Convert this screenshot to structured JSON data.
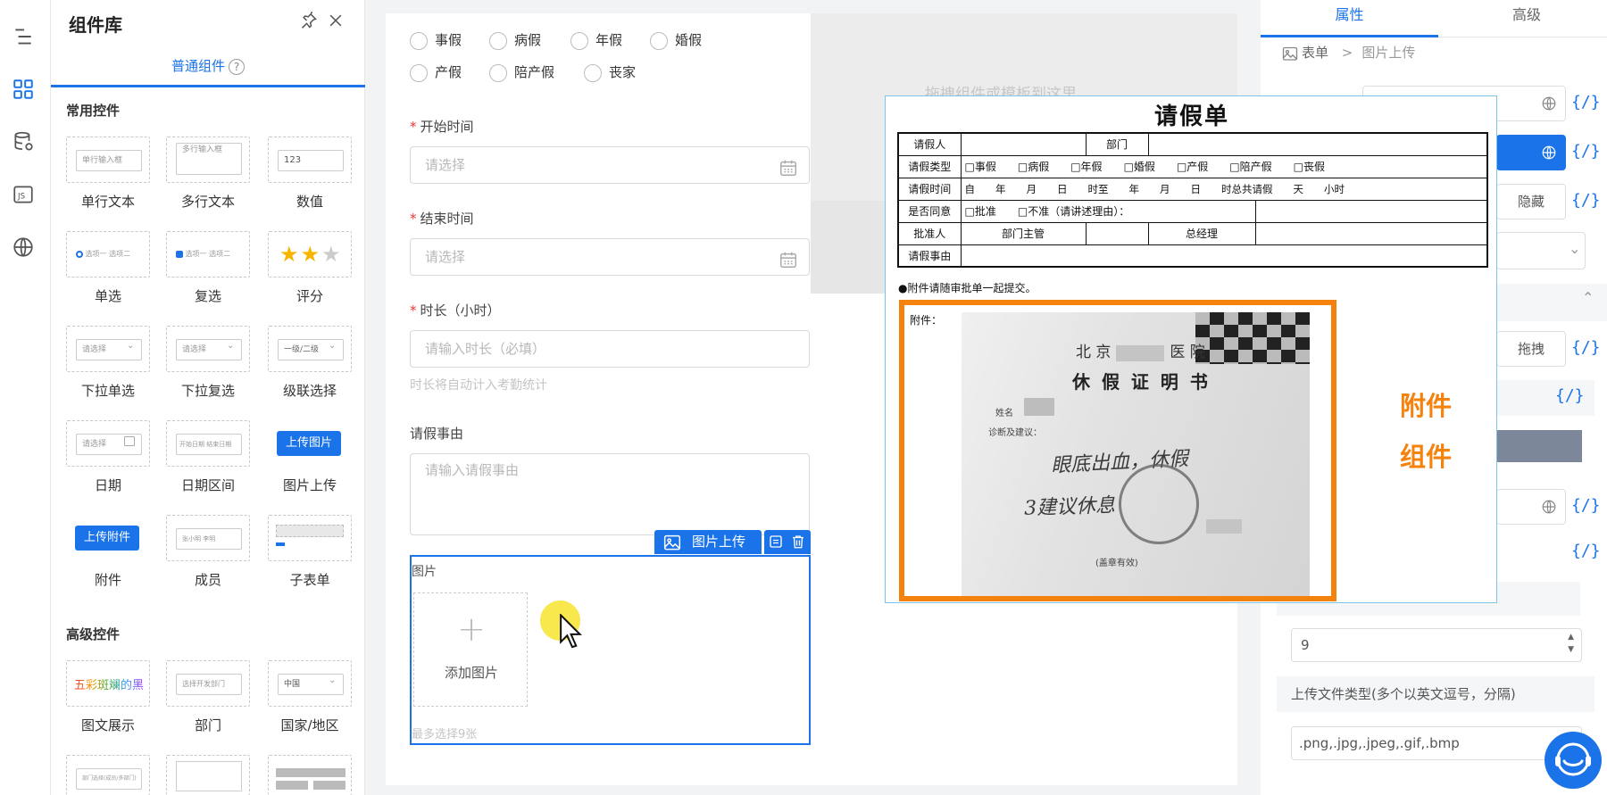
{
  "panel": {
    "title": "组件库",
    "tab_normal": "普通组件",
    "help": "?",
    "group_common": "常用控件",
    "group_advanced": "高级控件",
    "components": [
      {
        "label": "单行文本",
        "preview": "单行输入框"
      },
      {
        "label": "多行文本",
        "preview": "多行输入框"
      },
      {
        "label": "数值",
        "preview": "123"
      },
      {
        "label": "单选",
        "preview": "选项一 选项二"
      },
      {
        "label": "复选",
        "preview": "选项一 选项二"
      },
      {
        "label": "评分",
        "preview": ""
      },
      {
        "label": "下拉单选",
        "preview": "请选择"
      },
      {
        "label": "下拉复选",
        "preview": "请选择"
      },
      {
        "label": "级联选择",
        "preview": "一级/二级"
      },
      {
        "label": "日期",
        "preview": "请选择"
      },
      {
        "label": "日期区间",
        "preview": "开始日期 结束日期"
      },
      {
        "label": "图片上传",
        "preview": "上传图片"
      },
      {
        "label": "附件",
        "preview": "上传附件"
      },
      {
        "label": "成员",
        "preview": "张小明 李明"
      },
      {
        "label": "子表单",
        "preview": ""
      }
    ],
    "advanced": [
      {
        "label": "图文展示",
        "preview": "五彩斑斓的黑"
      },
      {
        "label": "部门",
        "preview": "选择开发部门"
      },
      {
        "label": "国家/地区",
        "preview": "中国"
      }
    ],
    "advanced_row2": [
      {
        "preview": "部门选择(成员/多部门)"
      }
    ]
  },
  "canvas": {
    "drag_hint": "拖拽组件或模板到这里",
    "leave_types": [
      "事假",
      "病假",
      "年假",
      "婚假",
      "产假",
      "陪产假",
      "丧家"
    ],
    "start_label": "开始时间",
    "start_placeholder": "请选择",
    "end_label": "结束时间",
    "end_placeholder": "请选择",
    "duration_label": "时长（小时）",
    "duration_placeholder": "请输入时长（必填）",
    "duration_hint": "时长将自动计入考勤统计",
    "reason_label": "请假事由",
    "reason_placeholder": "请输入请假事由",
    "widget_tag": "图片上传",
    "image_label": "图片",
    "add_image": "添加图片",
    "image_hint": "最多选择9张"
  },
  "right": {
    "tab_attr": "属性",
    "tab_adv": "高级",
    "crumb_form": "表单",
    "crumb_sep": ">",
    "crumb_current": "图片上传",
    "braces": "{/}",
    "btn_hide": "隐藏",
    "btn_drag": "拖拽",
    "max_count": "9",
    "file_type_label": "上传文件类型(多个以英文逗号，分隔)",
    "file_types": ".png,.jpg,.jpeg,.gif,.bmp"
  },
  "doc": {
    "title": "请假单",
    "applicant": "请假人",
    "dept": "部门",
    "type_label": "请假类型",
    "types": [
      "□事假",
      "□病假",
      "□年假",
      "□婚假",
      "□产假",
      "□陪产假",
      "□丧假"
    ],
    "time_label": "请假时间",
    "time_line": "自　　年　　月　　日　　时至　　年　　月　　日　　时总共请假　　天　　小时",
    "agree_label": "是否同意",
    "agree_yes": "□批准",
    "agree_no": "□不准（请讲述理由）：",
    "approver_label": "批准人",
    "manager": "部门主管",
    "gm": "总经理",
    "reason_label": "请假事由",
    "note": "●附件请随审批单一起提交。",
    "attach_label": "附件：",
    "photo_title_city": "北 京",
    "photo_title_hosp": "医 院",
    "photo_heading": "休 假 证 明 书",
    "photo_line1": "姓名",
    "photo_line2": "诊断及建议：",
    "photo_hand1": "眼底出血，休假",
    "photo_hand2": "3建议休息",
    "photo_sign": "(盖章有效)",
    "callout_1": "附件",
    "callout_2": "组件"
  }
}
